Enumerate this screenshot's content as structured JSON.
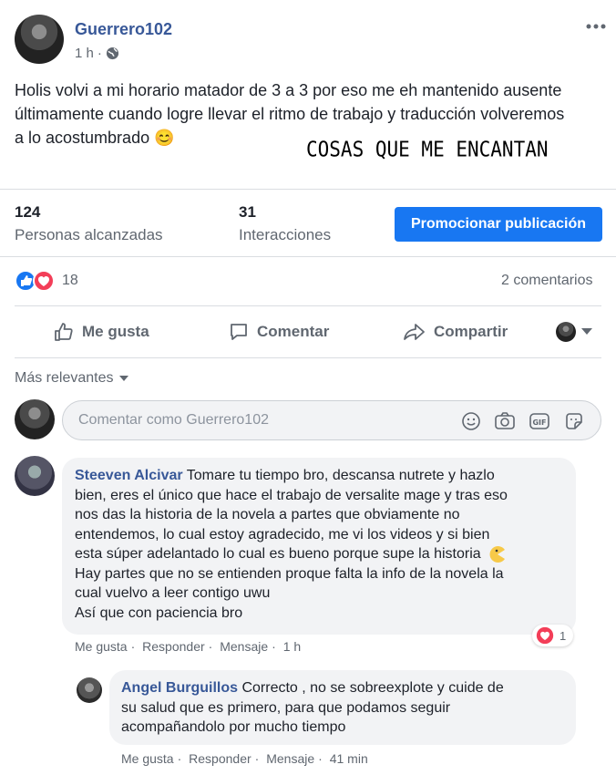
{
  "post": {
    "author": "Guerrero102",
    "time": "1 h",
    "body_lines": [
      "Holis volvi a mi horario matador de 3 a 3 por eso me eh mantenido ausente",
      "últimamente cuando logre llevar el ritmo de trabajo y traducción volveremos",
      "a lo acostumbrado"
    ],
    "emoji": "😊",
    "overlay_text": "COSAS QUE ME ENCANTAN"
  },
  "stats": {
    "reach_value": "124",
    "reach_label": "Personas alcanzadas",
    "interactions_value": "31",
    "interactions_label": "Interacciones",
    "promote_label": "Promocionar publicación"
  },
  "reactions": {
    "count": "18",
    "comments_label": "2 comentarios"
  },
  "actions": {
    "like": "Me gusta",
    "comment": "Comentar",
    "share": "Compartir"
  },
  "comments_section": {
    "sort_label": "Más relevantes",
    "input_placeholder": "Comentar como Guerrero102"
  },
  "comments": [
    {
      "author": "Steeven Alcivar",
      "lines": [
        "Tomare tu tiempo bro, descansa nutrete y hazlo",
        "bien, eres el único que hace el trabajo de versalite mage y tras eso",
        "nos das la historia de la novela a partes que obviamente no",
        "entendemos, lo cual estoy agradecido, me vi los videos y si bien",
        "esta súper adelantado lo cual es bueno porque supe la historia",
        "Hay partes que no se entienden proque falta la info de la novela la",
        "cual vuelvo a leer contigo uwu",
        "Así que con paciencia bro"
      ],
      "reaction_count": "1",
      "actions": [
        "Me gusta",
        "Responder",
        "Mensaje"
      ],
      "time": "1 h"
    },
    {
      "author": "Angel Burguillos",
      "lines": [
        "Correcto , no se sobreexplote y cuide de",
        "su salud que es primero, para que podamos seguir",
        "acompañandolo por mucho tiempo"
      ],
      "actions": [
        "Me gusta",
        "Responder",
        "Mensaje"
      ],
      "time": "41 min"
    }
  ],
  "colors": {
    "link": "#385898",
    "primary_button": "#1877f2",
    "muted": "#606770",
    "bubble": "#f2f3f5",
    "love": "#f33e58"
  }
}
